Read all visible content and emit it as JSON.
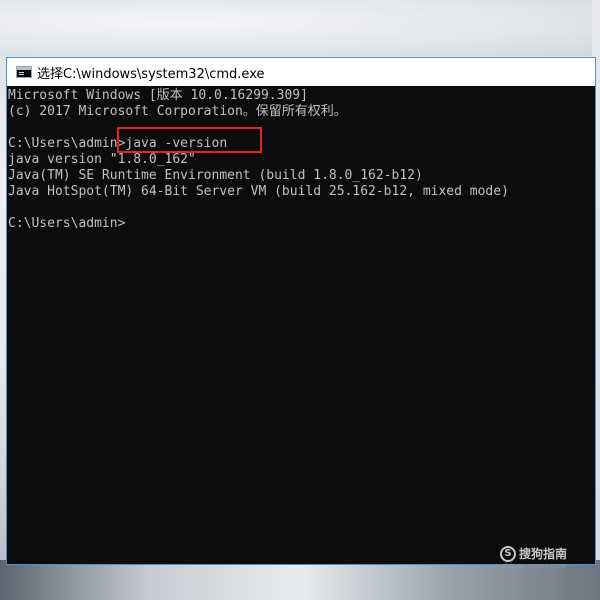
{
  "window": {
    "title": "选择C:\\windows\\system32\\cmd.exe",
    "icon": "cmd-icon"
  },
  "console": {
    "lines": [
      "Microsoft Windows [版本 10.0.16299.309]",
      "(c) 2017 Microsoft Corporation。保留所有权利。",
      "",
      "C:\\Users\\admin>java -version",
      "java version \"1.8.0_162\"",
      "Java(TM) SE Runtime Environment (build 1.8.0_162-b12)",
      "Java HotSpot(TM) 64-Bit Server VM (build 25.162-b12, mixed mode)",
      "",
      "C:\\Users\\admin>"
    ]
  },
  "watermark": {
    "icon_glyph": "S",
    "name": "搜狗指南",
    "url": "zhinan.sogou.com"
  },
  "colors": {
    "console_bg": "#0c0c0c",
    "console_text": "#c0c0c0",
    "highlight": "#e0251b"
  }
}
